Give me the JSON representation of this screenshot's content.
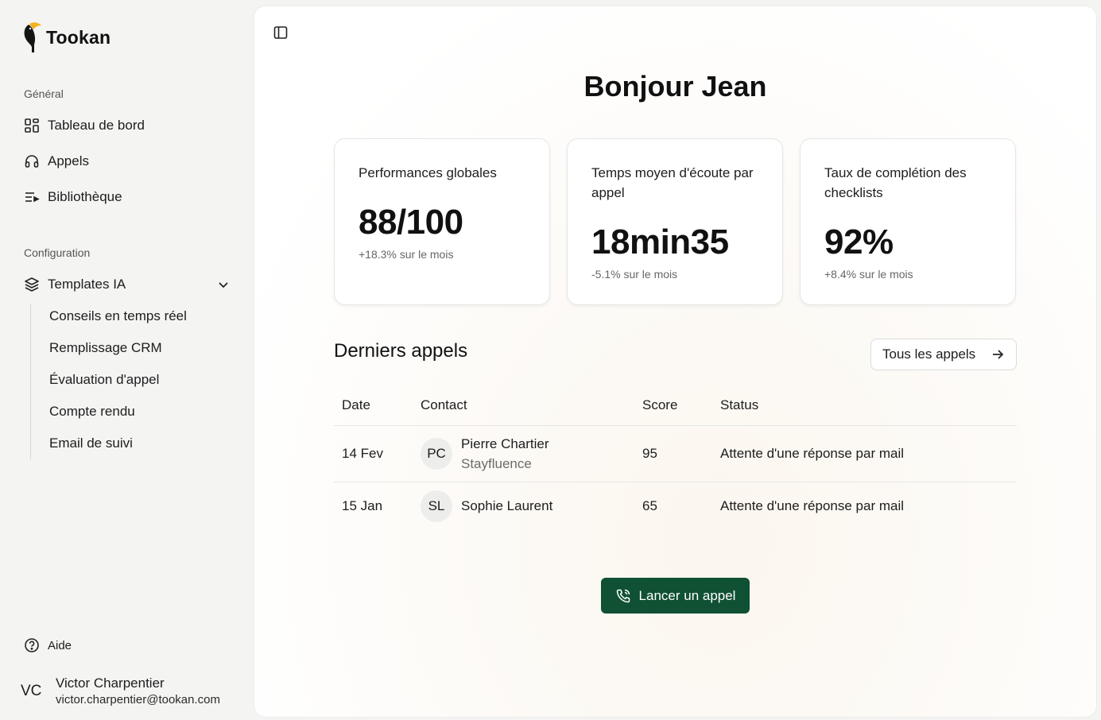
{
  "brand": {
    "name": "Tookan",
    "accent": "#0f5132",
    "logo_color": "#f2b21b"
  },
  "sidebar": {
    "general_label": "Général",
    "general_items": [
      {
        "label": "Tableau de bord",
        "icon": "grid-icon"
      },
      {
        "label": "Appels",
        "icon": "headphones-icon"
      },
      {
        "label": "Bibliothèque",
        "icon": "playlist-icon"
      }
    ],
    "config_label": "Configuration",
    "templates_label": "Templates IA",
    "templates_sub": [
      "Conseils en temps réel",
      "Remplissage CRM",
      "Évaluation d'appel",
      "Compte rendu",
      "Email de suivi"
    ],
    "help_label": "Aide",
    "user": {
      "initials": "VC",
      "name": "Victor Charpentier",
      "email": "victor.charpentier@tookan.com"
    }
  },
  "main": {
    "greeting": "Bonjour Jean",
    "cards": [
      {
        "title": "Performances globales",
        "value": "88/100",
        "trend": "+18.3% sur le mois"
      },
      {
        "title": "Temps moyen d'écoute par appel",
        "value": "18min35",
        "trend": "-5.1% sur le mois"
      },
      {
        "title": "Taux de complétion des checklists",
        "value": "92%",
        "trend": "+8.4% sur le mois"
      }
    ],
    "recent_title": "Derniers appels",
    "all_calls_label": "Tous les appels",
    "table": {
      "headers": [
        "Date",
        "Contact",
        "Score",
        "Status"
      ],
      "rows": [
        {
          "date": "14 Fev",
          "initials": "PC",
          "name": "Pierre Chartier",
          "company": "Stayfluence",
          "score": "95",
          "status": "Attente d'une réponse par mail"
        },
        {
          "date": "15 Jan",
          "initials": "SL",
          "name": "Sophie Laurent",
          "company": "",
          "score": "65",
          "status": "Attente d'une réponse par mail"
        }
      ]
    },
    "cta_label": "Lancer un appel"
  }
}
